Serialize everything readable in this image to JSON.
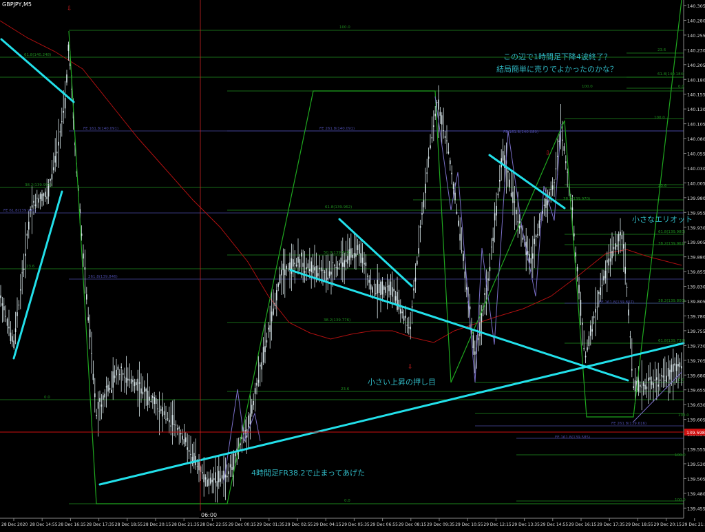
{
  "window": {
    "symbol_timeframe": "GBPJPY,M5"
  },
  "colors": {
    "background": "#000000",
    "candle": "#d8e6ea",
    "fib_green": "#1f8f1f",
    "fe_blue": "#4a4aa6",
    "trendline": "#22e0ea",
    "zigzag_green": "#1fa81f",
    "zigzag_violet": "#7a6fc8",
    "ma_red": "#b01010",
    "price_line": "#d01010",
    "annotation": "#2fb5c0"
  },
  "price_axis": {
    "labels": [
      "140.305",
      "140.280",
      "140.255",
      "140.230",
      "140.205",
      "140.180",
      "140.155",
      "140.130",
      "140.105",
      "140.080",
      "140.055",
      "140.030",
      "140.005",
      "139.980",
      "139.955",
      "139.930",
      "139.905",
      "139.880",
      "139.855",
      "139.830",
      "139.805",
      "139.780",
      "139.755",
      "139.730",
      "139.705",
      "139.680",
      "139.655",
      "139.630",
      "139.605",
      "139.580",
      "139.555",
      "139.530",
      "139.505",
      "139.480",
      "139.455"
    ],
    "current_price": "139.598"
  },
  "time_axis": {
    "labels": [
      "28 Dec 2020",
      "28 Dec 14:55",
      "28 Dec 16:15",
      "28 Dec 17:35",
      "28 Dec 18:55",
      "28 Dec 20:15",
      "28 Dec 21:35",
      "28 Dec 22:55",
      "29 Dec 00:15",
      "29 Dec 01:35",
      "29 Dec 02:55",
      "29 Dec 04:15",
      "29 Dec 05:35",
      "29 Dec 06:55",
      "29 Dec 08:15",
      "29 Dec 09:35",
      "29 Dec 10:55",
      "29 Dec 12:15",
      "29 Dec 13:35",
      "29 Dec 14:55",
      "29 Dec 16:15",
      "29 Dec 17:35",
      "29 Dec 18:55",
      "29 Dec 20:15",
      "29 Dec 21:35"
    ],
    "cursor_label": "06:00"
  },
  "fib_labels": {
    "l100_a": "100.0",
    "l618_a": "61.8(140.248)",
    "fe1618_a": "FE 161.8(140.091)",
    "l382_a": "38.2(139.991)",
    "fe618_a": "FE 61.8(139.941)",
    "l236_a": "23.6",
    "fe261_a": "261.8(139.846)",
    "l0_a": "0.0",
    "fe2618_b": "FE 261.8(140.091)",
    "l618_b": "61.8(139.962)",
    "l50_b": "50.0(139.876)",
    "l382_b": "38.2(139.776)",
    "l236_b": "23.6",
    "l0_b": "0.0",
    "l100_c": "100.0",
    "fe1618_c": "FE 161.8(140.080)",
    "l382_c": "38.2(139.970)",
    "l100_d": "100.0",
    "l0_d": "0.0",
    "l618_d": "61.8(140.184)",
    "l236_d": "23.6",
    "l382_d": "38.2(139.961)",
    "l618_d2": "61.8(139.980)",
    "fe1618_d": "FE 161.8(139.807)",
    "l382_d2": "38.2(139.800)",
    "l100_e": "100.0",
    "fe2618_e": "FE 261.8(139.616)",
    "fe1618_e": "FE 161.8(139.585)",
    "fe_e3": "FE 161.8(139.563)",
    "l618_e": "61.8(139.739)",
    "l0_e": "0.0",
    "l100_f": "100.0",
    "l100_g": "100.0"
  },
  "annotations": {
    "note1_line1": "この辺で1時間足下降4波終了？",
    "note1_line2": "結局簡単に売りでよかったのかな？",
    "note2": "小さなエリオット",
    "note3": "小さい上昇の押し目",
    "note4": "4時間足FR38.2で止まってあげた"
  }
}
